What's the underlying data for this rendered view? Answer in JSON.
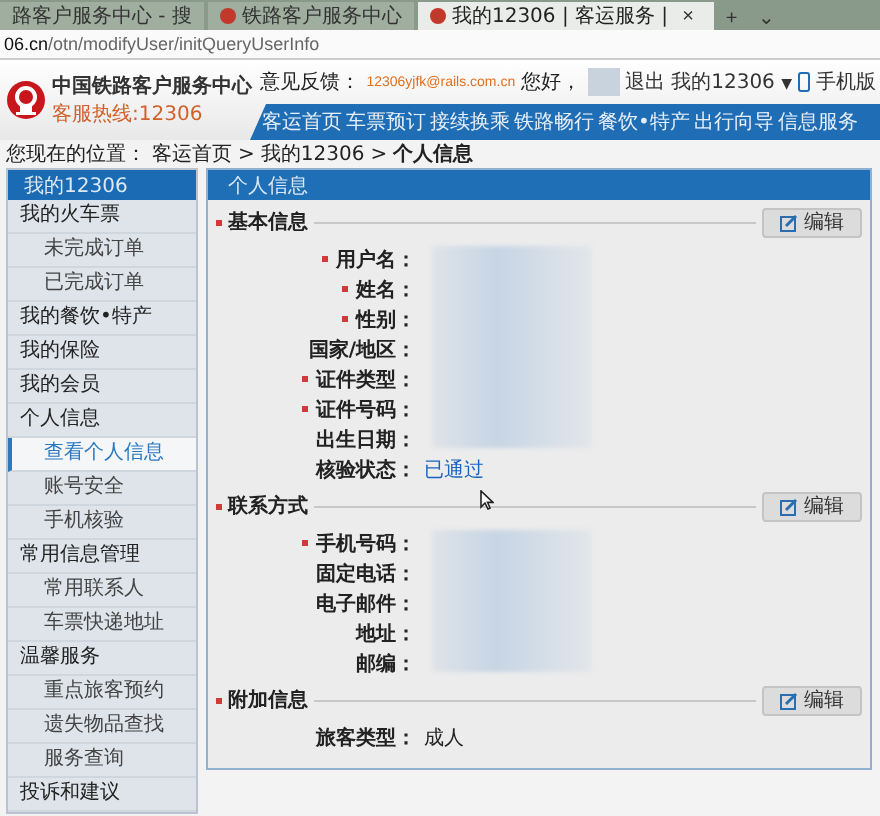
{
  "browser": {
    "tabs": [
      {
        "title": "路客户服务中心 - 搜",
        "selected": false,
        "favicon": false
      },
      {
        "title": "铁路客户服务中心",
        "selected": false,
        "favicon": true
      },
      {
        "title": "我的12306 | 客运服务 |",
        "selected": true,
        "favicon": true
      }
    ],
    "close_tab": "×",
    "new_tab": "+",
    "tab_menu": "⌄",
    "url_host": "06.cn",
    "url_path": "/otn/modifyUser/initQueryUserInfo"
  },
  "header": {
    "title": "中国铁路客户服务中心",
    "hotline": "客服热线:12306",
    "feedback_label": "意见反馈：",
    "feedback_email": "12306yjfk@rails.com.cn",
    "greeting": "您好，",
    "logout": "退出",
    "my_account": "我的12306",
    "my_account_caret": "▼",
    "mobile": "手机版",
    "nav": [
      {
        "label": "客运首页"
      },
      {
        "label": "车票预订"
      },
      {
        "label": "接续换乘"
      },
      {
        "label": "铁路畅行"
      },
      {
        "label": "餐饮•特产"
      },
      {
        "label": "出行向导"
      },
      {
        "label": "信息服务"
      }
    ]
  },
  "breadcrumb": {
    "prefix": "您现在的位置：",
    "items": [
      {
        "label": "客运首页",
        "current": false
      },
      {
        "label": "我的12306",
        "current": false
      },
      {
        "label": "个人信息",
        "current": true
      }
    ],
    "separator": ">"
  },
  "sidebar": {
    "title": "我的12306",
    "items": [
      {
        "label": "我的火车票",
        "selected": false,
        "children": [
          {
            "label": "未完成订单",
            "selected": false
          },
          {
            "label": "已完成订单",
            "selected": false
          }
        ]
      },
      {
        "label": "我的餐饮•特产",
        "selected": false
      },
      {
        "label": "我的保险",
        "selected": false
      },
      {
        "label": "我的会员",
        "selected": false
      },
      {
        "label": "个人信息",
        "selected": false,
        "children": [
          {
            "label": "查看个人信息",
            "selected": true
          },
          {
            "label": "账号安全",
            "selected": false
          },
          {
            "label": "手机核验",
            "selected": false
          }
        ]
      },
      {
        "label": "常用信息管理",
        "selected": false,
        "children": [
          {
            "label": "常用联系人",
            "selected": false
          },
          {
            "label": "车票快递地址",
            "selected": false
          }
        ]
      },
      {
        "label": "温馨服务",
        "selected": false,
        "children": [
          {
            "label": "重点旅客预约",
            "selected": false
          },
          {
            "label": "遗失物品查找",
            "selected": false
          },
          {
            "label": "服务查询",
            "selected": false
          }
        ]
      },
      {
        "label": "投诉和建议",
        "selected": false
      }
    ]
  },
  "panel": {
    "title": "个人信息",
    "sections": [
      {
        "title": "基本信息",
        "edit": "编辑",
        "blurred": true,
        "fields": [
          {
            "label": "用户名：",
            "required": true
          },
          {
            "label": "姓名：",
            "required": true
          },
          {
            "label": "性别：",
            "required": true
          },
          {
            "label": "国家/地区：",
            "required": false
          },
          {
            "label": "证件类型：",
            "required": true
          },
          {
            "label": "证件号码：",
            "required": true
          },
          {
            "label": "出生日期：",
            "required": false
          },
          {
            "label": "核验状态：",
            "required": false,
            "value": "已通过",
            "link": true
          }
        ]
      },
      {
        "title": "联系方式",
        "edit": "编辑",
        "blurred": true,
        "fields": [
          {
            "label": "手机号码：",
            "required": true
          },
          {
            "label": "固定电话：",
            "required": false
          },
          {
            "label": "电子邮件：",
            "required": false
          },
          {
            "label": "地址：",
            "required": false
          },
          {
            "label": "邮编：",
            "required": false
          }
        ]
      },
      {
        "title": "附加信息",
        "edit": "编辑",
        "fields": [
          {
            "label": "旅客类型：",
            "required": false,
            "value": "成人",
            "link": false
          }
        ]
      }
    ]
  }
}
